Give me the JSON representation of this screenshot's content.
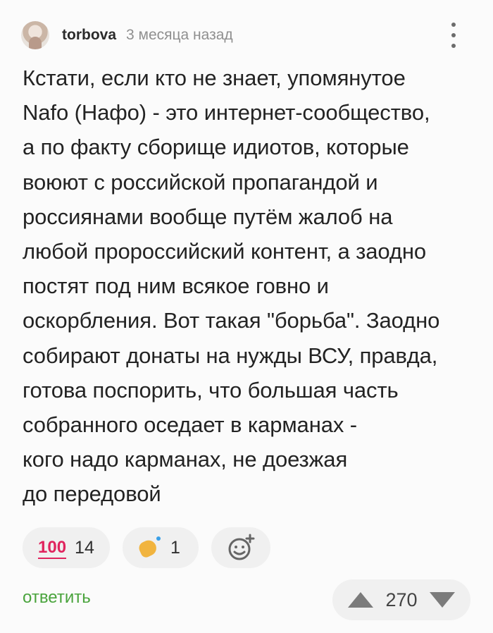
{
  "comment": {
    "author": "torbova",
    "time": "3 месяца назад",
    "text": "Кстати, если кто не знает, упомянутое\nNafo (Нафо) - это интернет-сообщество,\nа по факту сборище идиотов, которые\nвоюют с российской пропагандой и\nроссиянами вообще путём жалоб на\nлюбой пророссийский контент, а заодно\nпостят под ним всякое говно и\nоскорбления. Вот такая \"борьба\". Заодно\nсобирают донаты на нужды ВСУ, правда,\nготова поспорить, что большая часть\nсобранного оседает в карманах -\nкого надо карманах, не доезжая\nдо передовой"
  },
  "reactions": [
    {
      "emoji": "100",
      "icon": "hundred-points-icon",
      "count": "14"
    },
    {
      "icon": "clapping-hands-icon",
      "count": "1"
    }
  ],
  "actions": {
    "reply_label": "ответить",
    "score": "270"
  },
  "colors": {
    "accent_green": "#4aa43d",
    "reaction_red": "#e0245e"
  }
}
